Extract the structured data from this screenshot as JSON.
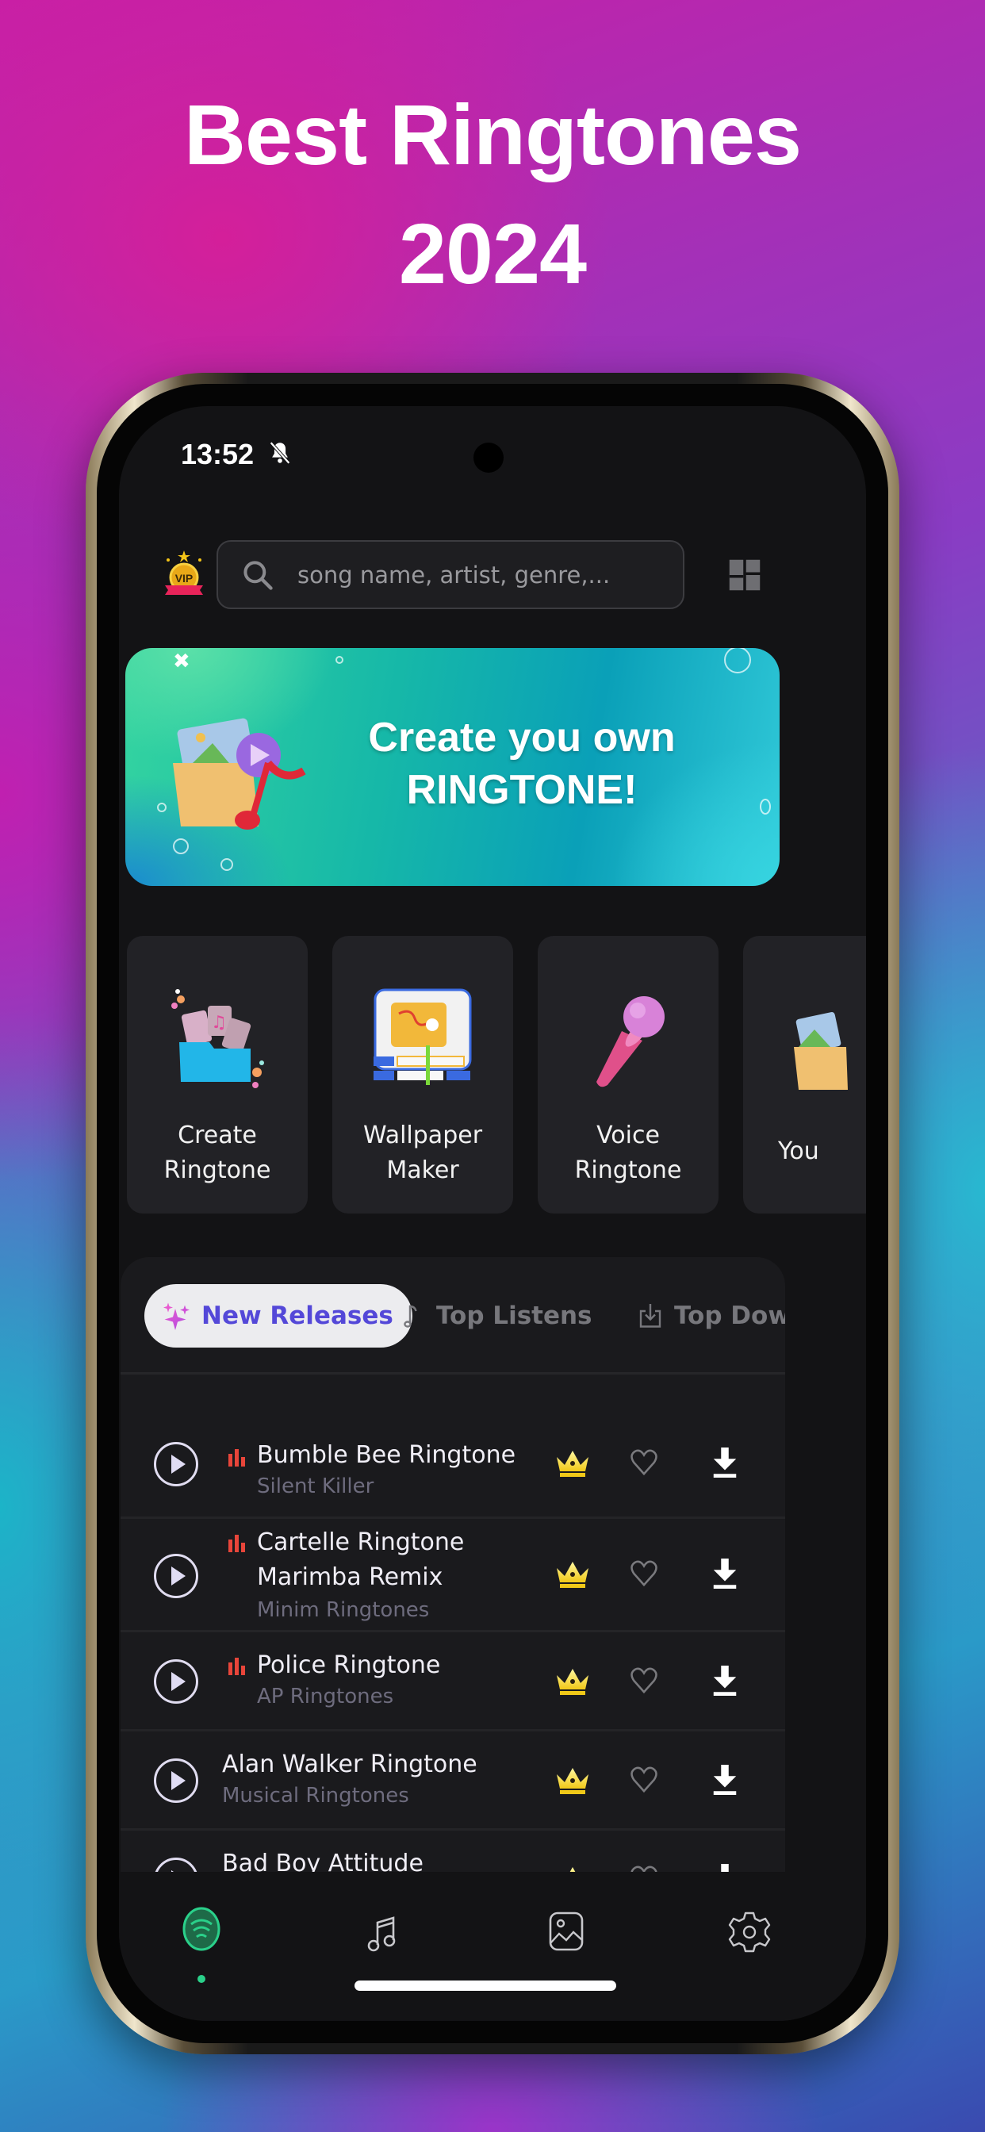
{
  "promo": {
    "headline_line1": "Best Ringtones",
    "headline_line2": "2024"
  },
  "status_bar": {
    "time": "13:52",
    "icons": [
      "bell-muted-icon"
    ]
  },
  "header": {
    "vip_badge": "VIP",
    "search_placeholder": "song name, artist, genre,...",
    "search_value": "",
    "right_icon": "layout-grid-icon"
  },
  "banner": {
    "line1": "Create you own",
    "line2": "RINGTONE!"
  },
  "features": [
    {
      "label_line1": "Create",
      "label_line2": "Ringtone",
      "icon": "folder-music-icon"
    },
    {
      "label_line1": "Wallpaper",
      "label_line2": "Maker",
      "icon": "wallpaper-editor-icon"
    },
    {
      "label_line1": "Voice",
      "label_line2": "Ringtone",
      "icon": "microphone-icon"
    },
    {
      "label_line1": "You",
      "label_line2": "",
      "icon": "folder-image-icon"
    }
  ],
  "tabs": [
    {
      "label": "New Releases",
      "icon": "sparkles-icon",
      "active": true
    },
    {
      "label": "Top Listens",
      "icon": "music-note-icon",
      "active": false
    },
    {
      "label": "Top Down",
      "icon": "download-box-icon",
      "active": false
    }
  ],
  "ringtones": [
    {
      "title": "Bumble Bee Ringtone",
      "title_line2": "",
      "artist": "Silent Killer",
      "trending": true,
      "premium": true
    },
    {
      "title": "Cartelle Ringtone",
      "title_line2": "Marimba Remix",
      "artist": "Minim Ringtones",
      "trending": true,
      "premium": true
    },
    {
      "title": "Police Ringtone",
      "title_line2": "",
      "artist": "AP Ringtones",
      "trending": true,
      "premium": true
    },
    {
      "title": "Alan Walker Ringtone",
      "title_line2": "",
      "artist": "Musical Ringtones",
      "trending": false,
      "premium": true
    },
    {
      "title": "Bad Boy Attitude",
      "title_line2": "",
      "artist": "",
      "trending": false,
      "premium": true
    }
  ],
  "bottom_nav": [
    {
      "name": "home",
      "icon": "wave-circle-icon",
      "active": true
    },
    {
      "name": "ringtones",
      "icon": "music-note-icon",
      "active": false
    },
    {
      "name": "wallpapers",
      "icon": "image-icon",
      "active": false
    },
    {
      "name": "settings",
      "icon": "gear-icon",
      "active": false
    }
  ],
  "colors": {
    "accent_active_tab_text": "#5448d8",
    "trending": "#e8453a",
    "nav_active": "#2ad08a",
    "crown": "#f5d830"
  }
}
